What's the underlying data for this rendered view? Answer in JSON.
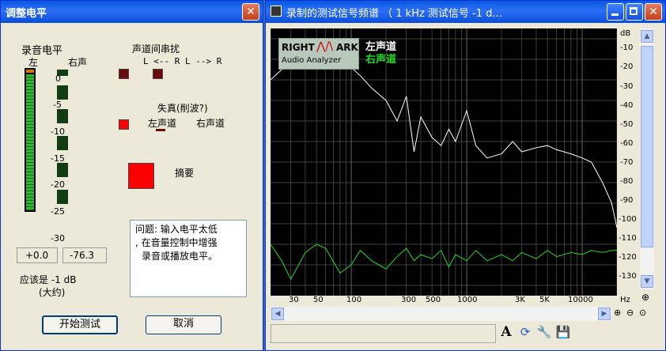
{
  "left_window": {
    "title": "调整电平",
    "close_glyph": "✕",
    "record_level_label": "录音电平",
    "left_label": "左",
    "right_label": "右声",
    "scale": [
      "0",
      "-5",
      "-10",
      "-15",
      "-20",
      "-25",
      "-30"
    ],
    "left_value": "+0.0",
    "right_value": "-76.3",
    "should_be": "应该是 -1 dB",
    "approx": "(大约)",
    "crosstalk_title": "声道间串扰",
    "crosstalk_dirs": "L <-- R  L --> R",
    "distortion_title": "失真(削波?)",
    "dist_left": "左声道",
    "dist_right": "右声道",
    "summary_label": "摘要",
    "problem_text": [
      "问题: 输入电平太低",
      ", 在音量控制中增强",
      "录音或播放电平。"
    ],
    "start_button": "开始测试",
    "cancel_button": "取消",
    "colors": {
      "meter_green": "#2fb52f",
      "meter_peak": "#e07000",
      "indicator_dark_red": "#6a0a0a",
      "indicator_red": "#ff0000"
    }
  },
  "right_window": {
    "title": "录制的测试信号频谱 （ 1 kHz 测试信号 -1 d...",
    "logo_top_left": "RIGHT",
    "logo_top_right": "ARK",
    "logo_bottom": "Audio Analyzer",
    "legend_left": "左声道",
    "legend_right": "右声道",
    "db_unit": "dB",
    "db_ticks": [
      "-10",
      "-20",
      "-30",
      "-40",
      "-50",
      "-60",
      "-70",
      "-80",
      "-90",
      "-100",
      "-110",
      "-120",
      "-130"
    ],
    "freq_ticks": [
      "30",
      "50",
      "100",
      "300",
      "500",
      "1000",
      "3K",
      "5K",
      "10000"
    ],
    "freq_unit": "Hz",
    "tool_font": "A",
    "colors": {
      "left_channel": "#ffffff",
      "right_channel": "#21d821",
      "grid": "#555555"
    }
  },
  "chart_data": {
    "type": "line",
    "xlabel": "Hz",
    "ylabel": "dB",
    "xscale": "log",
    "xlim": [
      20,
      20000
    ],
    "ylim": [
      -135,
      -5
    ],
    "series": [
      {
        "name": "左声道",
        "x": [
          20,
          25,
          30,
          40,
          50,
          60,
          70,
          80,
          100,
          120,
          150,
          200,
          250,
          300,
          350,
          400,
          500,
          600,
          700,
          800,
          1000,
          1200,
          1500,
          2000,
          2500,
          3000,
          4000,
          5000,
          6000,
          8000,
          10000,
          12000,
          15000,
          18000,
          20000
        ],
        "y": [
          -30,
          -25,
          -22,
          -20,
          -18,
          -17,
          -16,
          -22,
          -24,
          -28,
          -34,
          -40,
          -50,
          -38,
          -65,
          -48,
          -58,
          -62,
          -54,
          -60,
          -45,
          -62,
          -68,
          -66,
          -60,
          -65,
          -63,
          -62,
          -64,
          -66,
          -68,
          -70,
          -80,
          -90,
          -102
        ]
      },
      {
        "name": "右声道",
        "x": [
          20,
          25,
          30,
          40,
          50,
          60,
          80,
          100,
          120,
          150,
          200,
          250,
          300,
          350,
          400,
          500,
          600,
          700,
          800,
          1000,
          1200,
          1500,
          2000,
          2500,
          3000,
          4000,
          5000,
          6000,
          8000,
          10000,
          12000,
          15000,
          18000,
          20000
        ],
        "y": [
          -110,
          -118,
          -127,
          -114,
          -110,
          -112,
          -124,
          -120,
          -113,
          -118,
          -122,
          -116,
          -112,
          -118,
          -115,
          -117,
          -113,
          -121,
          -115,
          -118,
          -113,
          -118,
          -115,
          -118,
          -114,
          -117,
          -113,
          -116,
          -114,
          -115,
          -113,
          -114,
          -113,
          -113
        ]
      }
    ]
  }
}
